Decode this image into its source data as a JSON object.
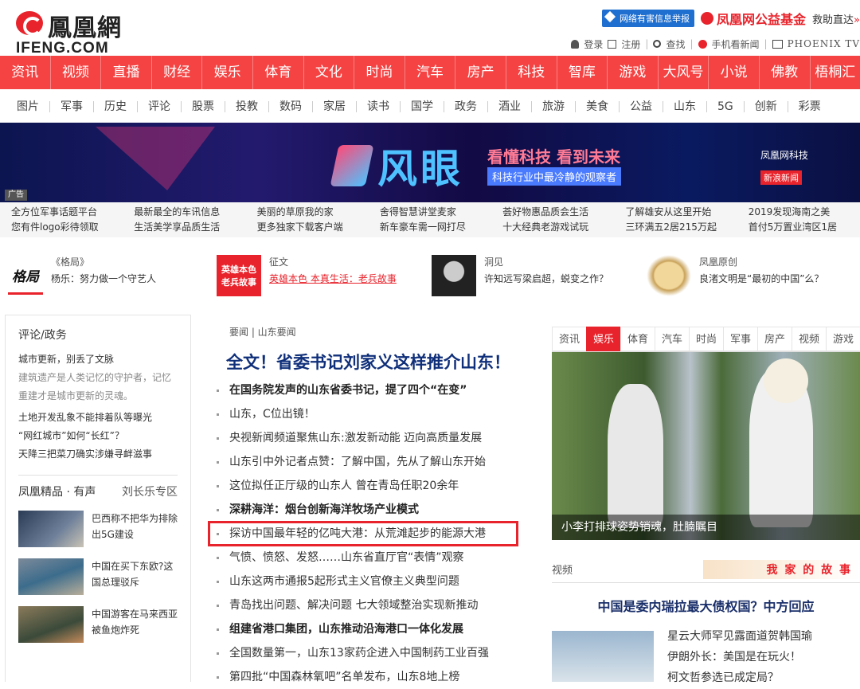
{
  "header": {
    "logo_cn": "鳳凰網",
    "logo_en": "IFENG.COM",
    "report_label": "网络有害信息举报",
    "fund_label": "凤凰网公益基金",
    "help_label": "救助直达",
    "help_arrow": "»",
    "login": "登录",
    "register": "注册",
    "search": "查找",
    "mobile": "手机看新闻",
    "tv": "PHOENIX TV"
  },
  "main_nav": [
    "资讯",
    "视频",
    "直播",
    "财经",
    "娱乐",
    "体育",
    "文化",
    "时尚",
    "汽车",
    "房产",
    "科技",
    "智库",
    "游戏",
    "大风号",
    "小说",
    "佛教",
    "梧桐汇"
  ],
  "sub_nav": [
    "图片",
    "军事",
    "历史",
    "评论",
    "股票",
    "投教",
    "数码",
    "家居",
    "读书",
    "国学",
    "政务",
    "酒业",
    "旅游",
    "美食",
    "公益",
    "山东",
    "5G",
    "创新",
    "彩票"
  ],
  "banner": {
    "brand": "风眼",
    "slogan": "看懂科技 看到未来",
    "tagline": "科技行业中最冷静的观察者",
    "right_brand": "凤凰网科技",
    "right_sub": "新浪新闻",
    "ad_label": "广告"
  },
  "ad_links": [
    [
      "全方位军事话题平台",
      "您有件logo彩待领取"
    ],
    [
      "最新最全的车讯信息",
      "生活美学享品质生活"
    ],
    [
      "美丽的草原我的家",
      "更多独家下载客户端"
    ],
    [
      "舍得智慧讲堂麦家",
      "新车豪车需一网打尽"
    ],
    [
      "荟好物惠品质会生活",
      "十大经典老游戏试玩"
    ],
    [
      "了解雄安从这里开始",
      "三环满五2居215万起"
    ],
    [
      "2019发现海南之美",
      "首付5万置业湾区1居"
    ]
  ],
  "featured": [
    {
      "thumb": "格局",
      "label": "《格局》",
      "title": "杨乐：努力做一个守艺人"
    },
    {
      "thumb": "英雄本色 老兵故事",
      "label": "征文",
      "title": "英雄本色 本真生活：老兵故事"
    },
    {
      "label": "洞见",
      "title": "许知远写梁启超，蜕变之作？"
    },
    {
      "label": "凤凰原创",
      "title": "良渚文明是“最初的中国”么？"
    }
  ],
  "left": {
    "heading": "评论/政务",
    "links": [
      "城市更新，别丢了文脉"
    ],
    "desc": "建筑遗产是人类记忆的守护者，记忆重建才是城市更新的灵魂。",
    "links2": [
      "土地开发乱象不能排着队等曝光",
      "“网红城市”如何“长红”？",
      "天降三把菜刀确实涉嫌寻衅滋事"
    ],
    "section2": "凤凰精品 · 有声",
    "section2_right": "刘长乐专区",
    "items": [
      {
        "title": "巴西称不把华为排除出5G建设"
      },
      {
        "title": "中国在买下东欧?这国总理驳斥"
      },
      {
        "title": "中国游客在马来西亚被鱼炮炸死"
      }
    ]
  },
  "center": {
    "crumb": "要闻 | 山东要闻",
    "headline": "全文！省委书记刘家义这样推介山东！",
    "news": [
      {
        "text": "在国务院发声的山东省委书记，提了四个“在变”",
        "style": "bold"
      },
      {
        "text": "山东，C位出镜！",
        "style": ""
      },
      {
        "text": "央视新闻频道聚焦山东:激发新动能 迈向高质量发展",
        "style": ""
      },
      {
        "text": "山东引中外记者点赞：了解中国，先从了解山东开始",
        "style": ""
      },
      {
        "text": "这位拟任正厅级的山东人 曾在青岛任职20余年",
        "style": ""
      },
      {
        "text": "深耕海洋：烟台创新海洋牧场产业模式",
        "style": "bold"
      },
      {
        "text": "探访中国最年轻的亿吨大港：从荒滩起步的能源大港",
        "style": "hl"
      },
      {
        "text": "气愤、愤怒、发怒……山东省直厅官“表情”观察",
        "style": ""
      },
      {
        "text": "山东这两市通报5起形式主义官僚主义典型问题",
        "style": ""
      },
      {
        "text": "青岛找出问题、解决问题 七大领域整治实现新推动",
        "style": ""
      },
      {
        "text": "组建省港口集团，山东推动沿海港口一体化发展",
        "style": "bold"
      },
      {
        "text": "全国数量第一，山东13家药企进入中国制药工业百强",
        "style": ""
      },
      {
        "text": "第四批“中国森林氧吧”名单发布，山东8地上榜",
        "style": ""
      }
    ]
  },
  "right": {
    "tabs": [
      "资讯",
      "娱乐",
      "体育",
      "汽车",
      "时尚",
      "军事",
      "房产",
      "视频",
      "游戏"
    ],
    "active_tab": "娱乐",
    "photo_caption": "小李打排球姿势销魂，肚腩瞩目",
    "video_label": "视频",
    "video_banner": "我 家 的 故 事",
    "video_title": "中国是委内瑞拉最大债权国？中方回应",
    "video_list": [
      "星云大师罕见露面道贺韩国瑜",
      "伊朗外长：美国是在玩火！",
      "柯文哲参选已成定局？"
    ]
  }
}
